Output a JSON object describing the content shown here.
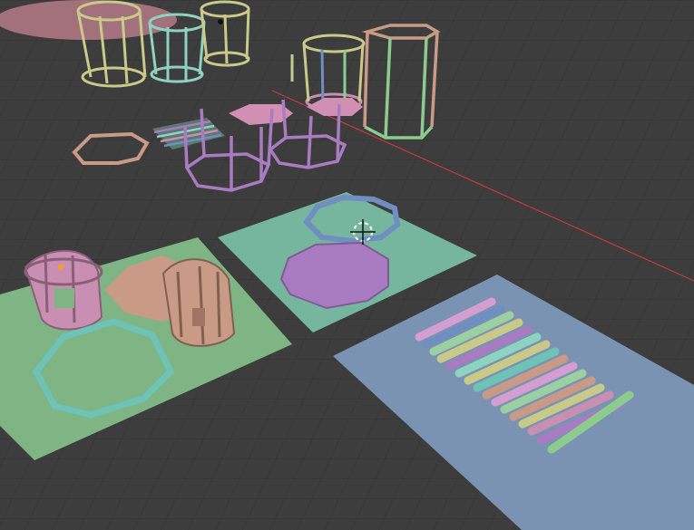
{
  "viewport": {
    "background": "#3d3d3d",
    "grid_color": "#2f2f2f",
    "x_axis_color": "#c43b3b"
  },
  "palette": {
    "pink": "#c98fb2",
    "purple": "#a97bc0",
    "mint": "#8ed3c0",
    "teal": "#6ec2b6",
    "yellow": "#c9c98a",
    "peach": "#c99b86",
    "green": "#8ecb8e",
    "blue": "#6f8fc1",
    "pale_green": "#8bc190",
    "board_blue": "#7a93b2",
    "board_teal": "#76b69e",
    "board_green": "#7fb585"
  },
  "objects": [
    {
      "name": "ground-disc-pink",
      "color": "pink"
    },
    {
      "name": "cage-yellow-large",
      "color": "yellow"
    },
    {
      "name": "cage-mint",
      "color": "mint"
    },
    {
      "name": "cage-yellow-small",
      "color": "yellow"
    },
    {
      "name": "cage-yellow-green-tall",
      "color": "green"
    },
    {
      "name": "cage-peach-green",
      "color": "peach"
    },
    {
      "name": "octagon-ring-peach",
      "color": "peach"
    },
    {
      "name": "striped-panel",
      "color": "blue"
    },
    {
      "name": "cage-purple-left",
      "color": "purple"
    },
    {
      "name": "cage-purple-right",
      "color": "purple"
    },
    {
      "name": "board-green",
      "color": "board_green"
    },
    {
      "name": "board-teal",
      "color": "board_teal"
    },
    {
      "name": "board-blue",
      "color": "board_blue"
    },
    {
      "name": "tube-pink",
      "color": "pink"
    },
    {
      "name": "tube-peach",
      "color": "peach"
    },
    {
      "name": "octagon-ring-teal",
      "color": "teal"
    },
    {
      "name": "octagon-plate-purple",
      "color": "purple"
    },
    {
      "name": "octagon-ring-blue",
      "color": "blue"
    },
    {
      "name": "rods-row",
      "color": "multi"
    },
    {
      "name": "3d-cursor",
      "color": "white"
    },
    {
      "name": "origin-point",
      "color": "orange"
    }
  ]
}
